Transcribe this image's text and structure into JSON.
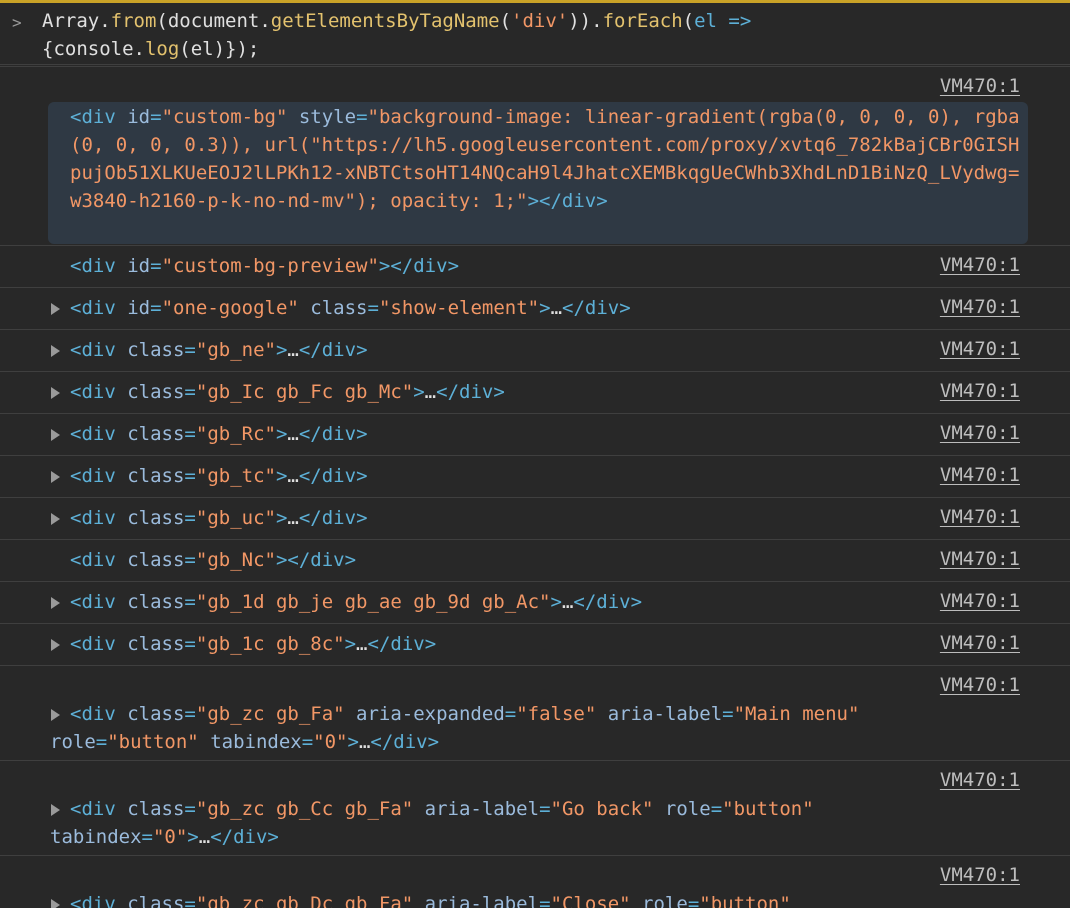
{
  "console": {
    "prompt_glyph": ">",
    "command": {
      "p1": "Array.",
      "from": "from",
      "p2": "(document.",
      "method": "getElementsByTagName",
      "p3": "(",
      "arg": "'div'",
      "p4": ")).",
      "foreach": "forEach",
      "p5": "(",
      "el": "el",
      "arrow": " =>",
      "line2a": "{console.",
      "log": "log",
      "line2b": "(el)});"
    },
    "source_label": "VM470:1",
    "entries": [
      {
        "text": "<div id=\"custom-bg\" style=\"background-image: linear-gradient(rgba(0, 0, 0, 0), rgba(0, 0, 0, 0.3)), url(\"https://lh5.googleusercontent.com/proxy/xvtq6_782kBajCBr0GISHpujOb51XLKUeEOJ2lLPKh12-xNBTCtsoHT14NQcaH9l4JhatcXEMBkqgUeCWhb3XhdLnD1BiNzQ_LVydwg=w3840-h2160-p-k-no-nd-mv\"); opacity: 1;\"></div>"
      },
      {
        "text": "<div id=\"custom-bg-preview\"></div>"
      },
      {
        "text": "<div id=\"one-google\" class=\"show-element\">…</div>"
      },
      {
        "text": "<div class=\"gb_ne\">…</div>"
      },
      {
        "text": "<div class=\"gb_Ic gb_Fc gb_Mc\">…</div>"
      },
      {
        "text": "<div class=\"gb_Rc\">…</div>"
      },
      {
        "text": "<div class=\"gb_tc\">…</div>"
      },
      {
        "text": "<div class=\"gb_uc\">…</div>"
      },
      {
        "text": "<div class=\"gb_Nc\"></div>"
      },
      {
        "text": "<div class=\"gb_1d gb_je gb_ae gb_9d gb_Ac\">…</div>"
      },
      {
        "text": "<div class=\"gb_1c gb_8c\">…</div>"
      },
      {
        "text": "<div class=\"gb_zc gb_Fa\" aria-expanded=\"false\" aria-label=\"Main menu\" role=\"button\" tabindex=\"0\">…</div>"
      },
      {
        "text": "<div class=\"gb_zc gb_Cc gb_Fa\" aria-label=\"Go back\" role=\"button\" tabindex=\"0\">…</div>"
      },
      {
        "text": "<div class=\"gb_zc gb_Dc gb_Fa\" aria-label=\"Close\" role=\"button\""
      }
    ]
  },
  "colors": {
    "tag": "#5db0d7",
    "attr": "#9bbbdc",
    "value": "#f29766",
    "highlight_bg": "#2f3944",
    "background": "#282828"
  }
}
